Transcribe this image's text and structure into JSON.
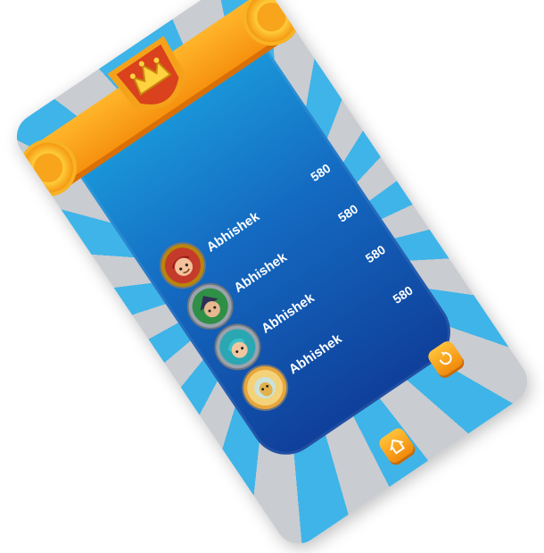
{
  "leaderboard": {
    "entries": [
      {
        "name": "Abhishek",
        "score": "580",
        "avatar": "boy-red-hair-avatar",
        "ring": "#b8860b"
      },
      {
        "name": "Abhishek",
        "score": "580",
        "avatar": "witch-green-hat-avatar",
        "ring": "#9aa3ad"
      },
      {
        "name": "Abhishek",
        "score": "580",
        "avatar": "knight-teal-avatar",
        "ring": "#9aa3ad"
      },
      {
        "name": "Abhishek",
        "score": "580",
        "avatar": "goldfish-helmet-avatar",
        "ring": "#e8a63a"
      }
    ]
  },
  "buttons": {
    "restart_icon": "restart-icon",
    "home_icon": "home-icon"
  },
  "colors": {
    "panel_top": "#1b9bdc",
    "panel_bottom": "#0f3f9a",
    "ray_blue": "#3fb4e8",
    "ray_gray": "#c9ccd1",
    "accent_orange": "#f58e0c",
    "shield_red": "#d9421c"
  }
}
